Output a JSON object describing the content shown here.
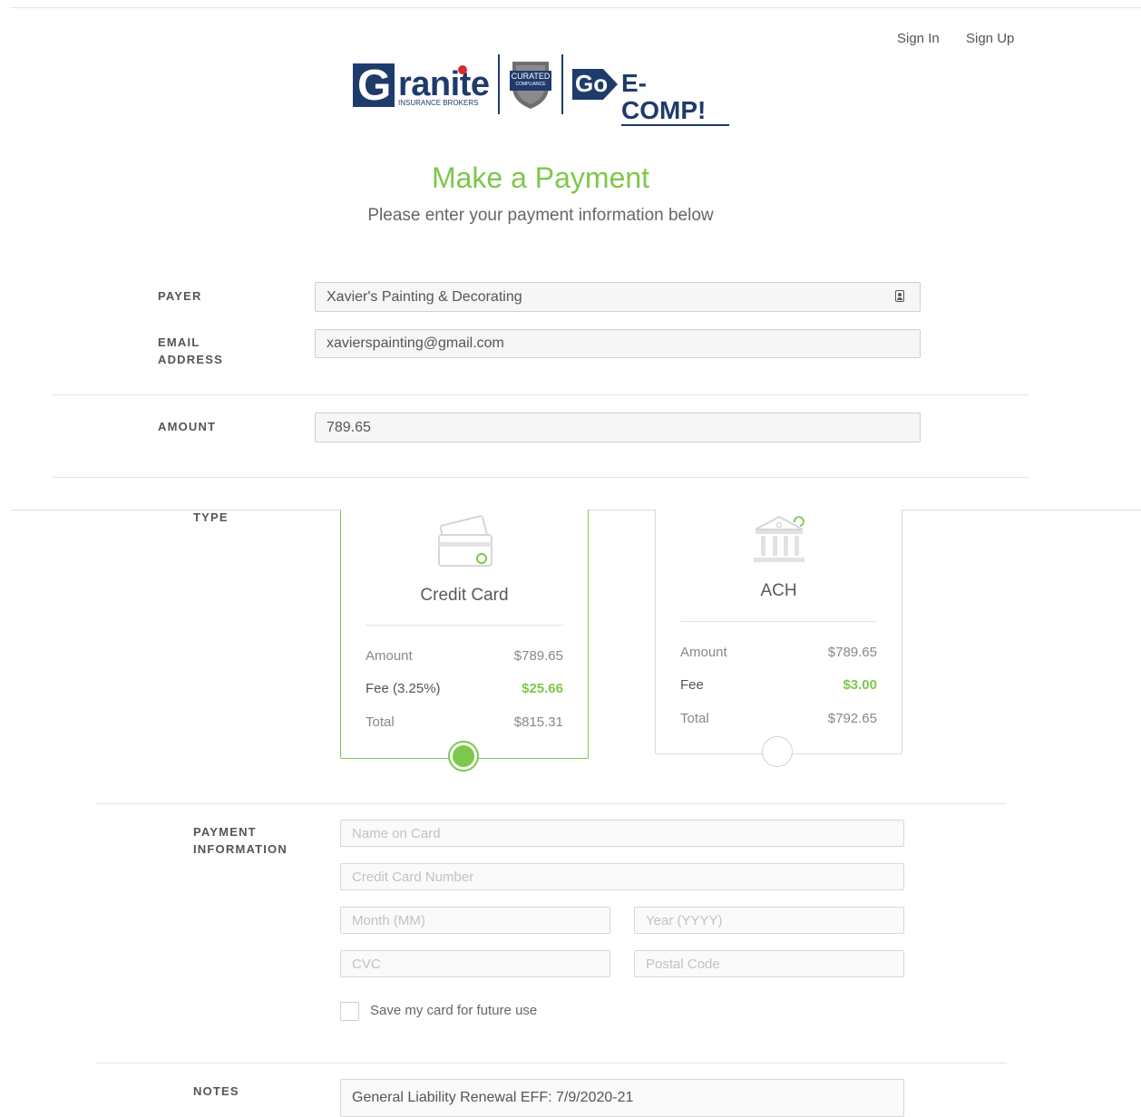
{
  "nav": {
    "sign_in": "Sign In",
    "sign_up": "Sign Up"
  },
  "logo": {
    "granite_g": "G",
    "granite_rest": "ranite",
    "granite_sub": "INSURANCE BROKERS",
    "curated_line1": "CURATED",
    "curated_line2": "COMPLIANCE",
    "go_text": "Go",
    "ecomp_text": "E-COMP!"
  },
  "header": {
    "title": "Make a Payment",
    "subtitle": "Please enter your payment information below"
  },
  "form": {
    "payer_label": "PAYER",
    "payer_value": "Xavier's Painting & Decorating",
    "email_label_1": "EMAIL",
    "email_label_2": "ADDRESS",
    "email_value": "xavierspainting@gmail.com",
    "amount_label": "AMOUNT",
    "amount_value": "789.65",
    "type_label": "TYPE"
  },
  "payment_types": {
    "credit_card": {
      "title": "Credit Card",
      "amount_label": "Amount",
      "amount_value": "$789.65",
      "fee_label": "Fee (3.25%)",
      "fee_value": "$25.66",
      "total_label": "Total",
      "total_value": "$815.31",
      "selected": true
    },
    "ach": {
      "title": "ACH",
      "amount_label": "Amount",
      "amount_value": "$789.65",
      "fee_label": "Fee",
      "fee_value": "$3.00",
      "total_label": "Total",
      "total_value": "$792.65",
      "selected": false
    }
  },
  "payment_info": {
    "label_1": "PAYMENT",
    "label_2": "INFORMATION",
    "name_placeholder": "Name on Card",
    "card_number_placeholder": "Credit Card Number",
    "month_placeholder": "Month (MM)",
    "year_placeholder": "Year (YYYY)",
    "cvc_placeholder": "CVC",
    "postal_placeholder": "Postal Code",
    "save_card_label": "Save my card for future use"
  },
  "notes": {
    "label": "NOTES",
    "value": "General Liability Renewal EFF: 7/9/2020-21"
  },
  "colors": {
    "accent_green": "#7cc84c",
    "brand_navy": "#1f3b6b"
  }
}
